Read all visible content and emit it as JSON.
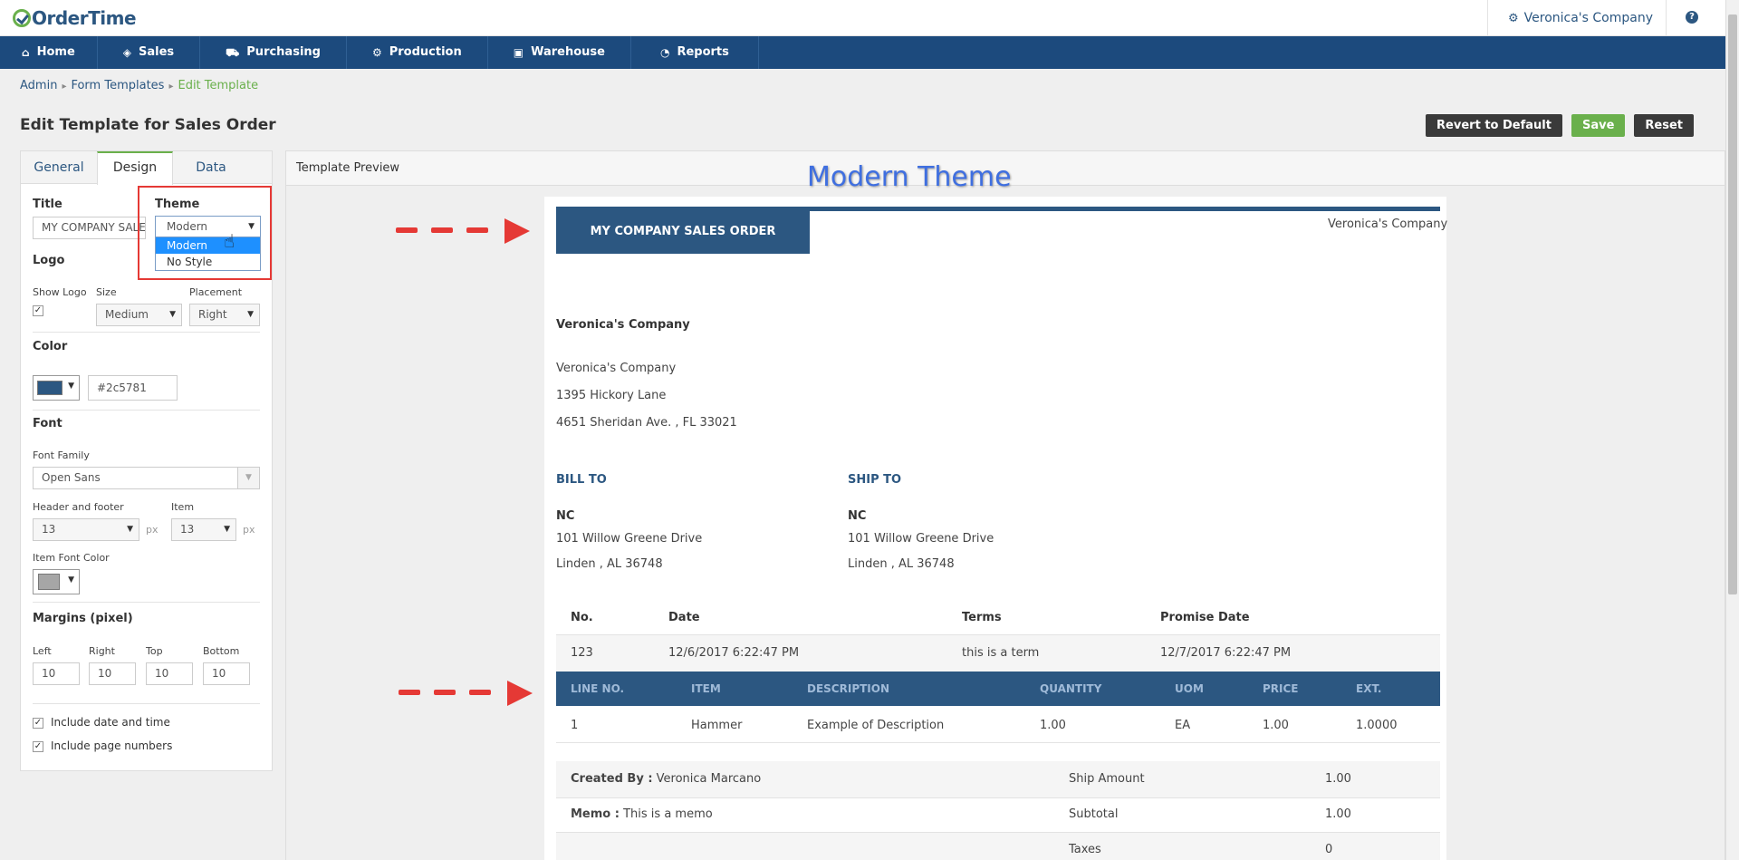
{
  "app": {
    "logo": "OrderTime",
    "company": "Veronica's Company",
    "help": "?"
  },
  "nav": [
    "Home",
    "Sales",
    "Purchasing",
    "Production",
    "Warehouse",
    "Reports"
  ],
  "breadcrumb": {
    "a": "Admin",
    "b": "Form Templates",
    "c": "Edit Template"
  },
  "page": {
    "title": "Edit Template for Sales Order"
  },
  "actions": {
    "revert": "Revert to Default",
    "save": "Save",
    "reset": "Reset"
  },
  "tabs": [
    "General",
    "Design",
    "Data"
  ],
  "design": {
    "title_label": "Title",
    "title_value": "MY COMPANY SALES ORDER",
    "theme_label": "Theme",
    "theme_value": "Modern",
    "theme_options": [
      "Modern",
      "No Style"
    ],
    "logo_label": "Logo",
    "show_logo_label": "Show Logo",
    "size_label": "Size",
    "size_value": "Medium",
    "placement_label": "Placement",
    "placement_value": "Right",
    "color_label": "Color",
    "color_value": "#2c5781",
    "font_label": "Font",
    "font_family_label": "Font Family",
    "font_family_value": "Open Sans",
    "header_footer_label": "Header and footer",
    "header_footer_value": "13",
    "item_label": "Item",
    "item_value": "13",
    "px": "px",
    "item_font_color_label": "Item Font Color",
    "item_font_color": "#a6a6a6",
    "margins_label": "Margins (pixel)",
    "margin_left_label": "Left",
    "margin_left": "10",
    "margin_right_label": "Right",
    "margin_right": "10",
    "margin_top_label": "Top",
    "margin_top": "10",
    "margin_bottom_label": "Bottom",
    "margin_bottom": "10",
    "include_date": "Include date and time",
    "include_pages": "Include page numbers"
  },
  "preview": {
    "header": "Template Preview",
    "annotation": "Modern Theme",
    "doc_title": "MY COMPANY SALES ORDER",
    "company_top": "Veronica's Company",
    "company_bold": "Veronica's Company",
    "company_name": "Veronica's Company",
    "addr1": "1395 Hickory Lane",
    "addr2": "4651 Sheridan Ave. , FL 33021",
    "bill_to": "BILL TO",
    "ship_to": "SHIP TO",
    "bill_name": "NC",
    "bill_addr1": "101 Willow Greene Drive",
    "bill_addr2": "Linden , AL 36748",
    "ship_name": "NC",
    "ship_addr1": "101 Willow Greene Drive",
    "ship_addr2": "Linden , AL 36748",
    "order_headers": {
      "no": "No.",
      "date": "Date",
      "terms": "Terms",
      "promise": "Promise Date"
    },
    "order_values": {
      "no": "123",
      "date": "12/6/2017 6:22:47 PM",
      "terms": "this is a term",
      "promise": "12/7/2017 6:22:47 PM"
    },
    "item_headers": {
      "line": "LINE NO.",
      "item": "ITEM",
      "desc": "DESCRIPTION",
      "qty": "QUANTITY",
      "uom": "UOM",
      "price": "PRICE",
      "ext": "EXT."
    },
    "item_row": {
      "line": "1",
      "item": "Hammer",
      "desc": "Example of Description",
      "qty": "1.00",
      "uom": "EA",
      "price": "1.00",
      "ext": "1.0000"
    },
    "created_by_label": "Created By :",
    "created_by": "Veronica Marcano",
    "memo_label": "Memo :",
    "memo": "This is a memo",
    "ship_amount_label": "Ship Amount",
    "ship_amount": "1.00",
    "subtotal_label": "Subtotal",
    "subtotal": "1.00",
    "taxes_label": "Taxes",
    "taxes": "0"
  }
}
